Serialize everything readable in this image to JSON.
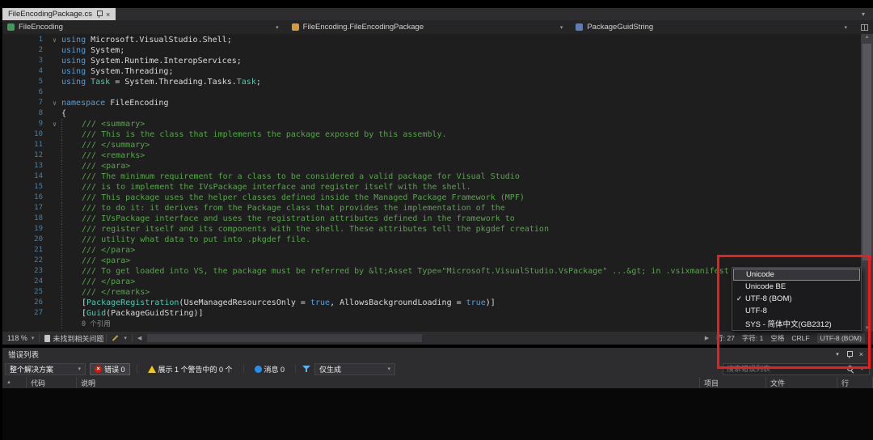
{
  "icons": {
    "chevron_down": "▾",
    "close": "×",
    "check": "✓",
    "fold_open": "∨",
    "scroll_left": "◀",
    "scroll_right": "▶",
    "scroll_up": "▲",
    "scroll_down": "▼",
    "sort_asc": "▲"
  },
  "tabbar": {
    "tab": {
      "title": "FileEncodingPackage.cs"
    }
  },
  "navbar": {
    "project": "FileEncoding",
    "type": "FileEncoding.FileEncodingPackage",
    "member": "PackageGuidString"
  },
  "editor": {
    "fold_glyph": "∨",
    "lines": [
      {
        "n": 1,
        "fold": true,
        "tokens": [
          {
            "t": "k",
            "s": "using "
          },
          {
            "t": "p",
            "s": "Microsoft.VisualStudio.Shell;"
          }
        ]
      },
      {
        "n": 2,
        "tokens": [
          {
            "t": "k",
            "s": "using "
          },
          {
            "t": "p",
            "s": "System;"
          }
        ]
      },
      {
        "n": 3,
        "tokens": [
          {
            "t": "k",
            "s": "using "
          },
          {
            "t": "p",
            "s": "System.Runtime.InteropServices;"
          }
        ]
      },
      {
        "n": 4,
        "tokens": [
          {
            "t": "k",
            "s": "using "
          },
          {
            "t": "p",
            "s": "System.Threading;"
          }
        ]
      },
      {
        "n": 5,
        "tokens": [
          {
            "t": "k",
            "s": "using "
          },
          {
            "t": "t",
            "s": "Task"
          },
          {
            "t": "p",
            "s": " = "
          },
          {
            "t": "p",
            "s": "System.Threading.Tasks."
          },
          {
            "t": "t",
            "s": "Task"
          },
          {
            "t": "p",
            "s": ";"
          }
        ]
      },
      {
        "n": 6,
        "tokens": []
      },
      {
        "n": 7,
        "fold": true,
        "tokens": [
          {
            "t": "k",
            "s": "namespace "
          },
          {
            "t": "p",
            "s": "FileEncoding"
          }
        ]
      },
      {
        "n": 8,
        "tokens": [
          {
            "t": "p",
            "s": "{"
          }
        ]
      },
      {
        "n": 9,
        "fold": true,
        "g": 1,
        "tokens": [
          {
            "t": "c",
            "s": "/// <summary>"
          }
        ]
      },
      {
        "n": 10,
        "g": 1,
        "tokens": [
          {
            "t": "c",
            "s": "/// This is the class that implements the package exposed by this assembly."
          }
        ]
      },
      {
        "n": 11,
        "g": 1,
        "tokens": [
          {
            "t": "c",
            "s": "/// </summary>"
          }
        ]
      },
      {
        "n": 12,
        "g": 1,
        "tokens": [
          {
            "t": "c",
            "s": "/// <remarks>"
          }
        ]
      },
      {
        "n": 13,
        "g": 1,
        "tokens": [
          {
            "t": "c",
            "s": "/// <para>"
          }
        ]
      },
      {
        "n": 14,
        "g": 1,
        "tokens": [
          {
            "t": "c",
            "s": "/// The minimum requirement for a class to be considered a valid package for Visual Studio"
          }
        ]
      },
      {
        "n": 15,
        "g": 1,
        "tokens": [
          {
            "t": "c",
            "s": "/// is to implement the IVsPackage interface and register itself with the shell."
          }
        ]
      },
      {
        "n": 16,
        "g": 1,
        "tokens": [
          {
            "t": "c",
            "s": "/// This package uses the helper classes defined inside the Managed Package Framework (MPF)"
          }
        ]
      },
      {
        "n": 17,
        "g": 1,
        "tokens": [
          {
            "t": "c",
            "s": "/// to do it: it derives from the Package class that provides the implementation of the"
          }
        ]
      },
      {
        "n": 18,
        "g": 1,
        "tokens": [
          {
            "t": "c",
            "s": "/// IVsPackage interface and uses the registration attributes defined in the framework to"
          }
        ]
      },
      {
        "n": 19,
        "g": 1,
        "tokens": [
          {
            "t": "c",
            "s": "/// register itself and its components with the shell. These attributes tell the pkgdef creation"
          }
        ]
      },
      {
        "n": 20,
        "g": 1,
        "tokens": [
          {
            "t": "c",
            "s": "/// utility what data to put into .pkgdef file."
          }
        ]
      },
      {
        "n": 21,
        "g": 1,
        "tokens": [
          {
            "t": "c",
            "s": "/// </para>"
          }
        ]
      },
      {
        "n": 22,
        "g": 1,
        "tokens": [
          {
            "t": "c",
            "s": "/// <para>"
          }
        ]
      },
      {
        "n": 23,
        "g": 1,
        "tokens": [
          {
            "t": "c",
            "s": "/// To get loaded into VS, the package must be referred by &lt;Asset Type=\"Microsoft.VisualStudio.VsPackage\" ...&gt; in .vsixmanifest file."
          }
        ]
      },
      {
        "n": 24,
        "g": 1,
        "tokens": [
          {
            "t": "c",
            "s": "/// </para>"
          }
        ]
      },
      {
        "n": 25,
        "g": 1,
        "tokens": [
          {
            "t": "c",
            "s": "/// </remarks>"
          }
        ]
      },
      {
        "n": 26,
        "g": 1,
        "tokens": [
          {
            "t": "p",
            "s": "["
          },
          {
            "t": "t",
            "s": "PackageRegistration"
          },
          {
            "t": "p",
            "s": "(UseManagedResourcesOnly = "
          },
          {
            "t": "k",
            "s": "true"
          },
          {
            "t": "p",
            "s": ", AllowsBackgroundLoading = "
          },
          {
            "t": "k",
            "s": "true"
          },
          {
            "t": "p",
            "s": ")]"
          }
        ]
      },
      {
        "n": 27,
        "g": 1,
        "tokens": [
          {
            "t": "p",
            "s": "["
          },
          {
            "t": "t",
            "s": "Guid"
          },
          {
            "t": "p",
            "s": "(PackageGuidString)]"
          }
        ]
      },
      {
        "lens": true,
        "g": 1,
        "tokens": [
          {
            "t": "l",
            "s": "0 个引用"
          }
        ]
      }
    ]
  },
  "editor_bar": {
    "zoom": "118 %",
    "health": "未找到相关问题",
    "status_items": [
      {
        "name": "line-indicator",
        "label": "行: 27"
      },
      {
        "name": "column-indicator",
        "label": "字符: 1"
      },
      {
        "name": "spaces-indicator",
        "label": "空格"
      },
      {
        "name": "line-ending-indicator",
        "label": "CRLF"
      },
      {
        "name": "encoding-indicator",
        "label": "UTF-8 (BOM)",
        "active": true
      }
    ]
  },
  "encoding_menu": {
    "check_glyph": "✓",
    "items": [
      {
        "label": "Unicode",
        "checked": false,
        "focused": true
      },
      {
        "label": "Unicode BE",
        "checked": false,
        "focused": false
      },
      {
        "label": "UTF-8 (BOM)",
        "checked": true,
        "focused": false
      },
      {
        "label": "UTF-8",
        "checked": false,
        "focused": false
      },
      {
        "label": "SYS - 简体中文(GB2312)",
        "checked": false,
        "focused": false
      }
    ]
  },
  "error_list": {
    "title": "错误列表",
    "scope": "整个解决方案",
    "errors": "错误 0",
    "warnings": "展示 1 个警告中的 0 个",
    "messages": "消息 0",
    "filter": "仅生成",
    "search_placeholder": "搜索错误列表",
    "columns": [
      {
        "name": "col-severity",
        "label": ""
      },
      {
        "name": "col-code",
        "label": "代码"
      },
      {
        "name": "col-description",
        "label": "说明"
      },
      {
        "name": "col-project",
        "label": "项目"
      },
      {
        "name": "col-file",
        "label": "文件"
      },
      {
        "name": "col-line",
        "label": "行"
      }
    ]
  }
}
